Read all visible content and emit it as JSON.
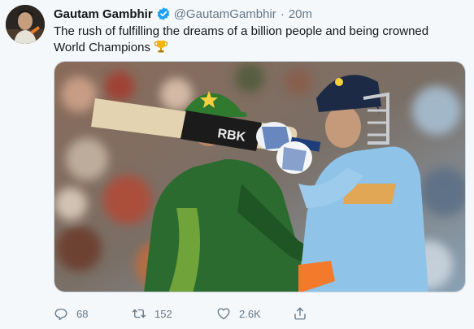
{
  "tweet": {
    "author_name": "Gautam Gambhir",
    "handle": "@GautamGambhir",
    "separator": "·",
    "time": "20m",
    "text": "The rush of fulfilling the dreams of a billion people and being crowned World Champions",
    "emoji": "trophy-icon",
    "bat_brand": "RBK"
  },
  "actions": {
    "reply_count": "68",
    "retweet_count": "152",
    "like_count": "2.6K",
    "share_icon": "share-icon"
  },
  "colors": {
    "background": "#f5f8fa",
    "text": "#14171a",
    "muted": "#657786",
    "verified": "#1da1f2",
    "pakistan_green": "#2c6b2f",
    "india_blue": "#8fc3e8"
  }
}
